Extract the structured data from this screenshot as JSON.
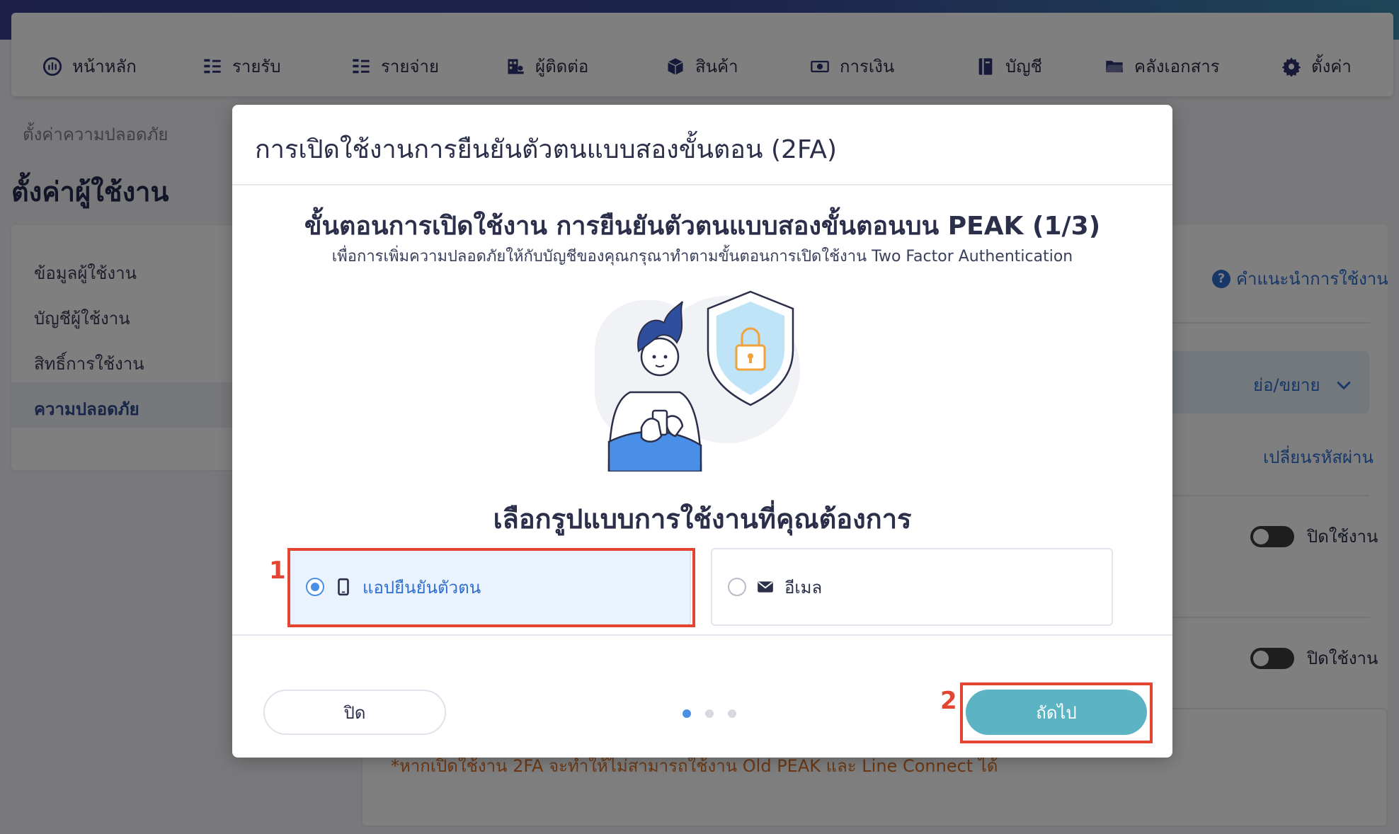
{
  "nav": {
    "items": [
      {
        "label": "หน้าหลัก",
        "icon": "dashboard-icon"
      },
      {
        "label": "รายรับ",
        "icon": "income-icon"
      },
      {
        "label": "รายจ่าย",
        "icon": "expense-icon"
      },
      {
        "label": "ผู้ติดต่อ",
        "icon": "contacts-icon"
      },
      {
        "label": "สินค้า",
        "icon": "product-box-icon"
      },
      {
        "label": "การเงิน",
        "icon": "money-icon"
      },
      {
        "label": "บัญชี",
        "icon": "ledger-book-icon"
      },
      {
        "label": "คลังเอกสาร",
        "icon": "folder-icon"
      },
      {
        "label": "ตั้งค่า",
        "icon": "gear-icon"
      }
    ]
  },
  "page": {
    "breadcrumb": "ตั้งค่าความปลอดภัย",
    "title": "ตั้งค่าผู้ใช้งาน",
    "sidebar": {
      "items": [
        {
          "label": "ข้อมูลผู้ใช้งาน",
          "active": false
        },
        {
          "label": "บัญชีผู้ใช้งาน",
          "active": false
        },
        {
          "label": "สิทธิ์การใช้งาน",
          "active": false
        },
        {
          "label": "ความปลอดภัย",
          "active": true
        }
      ]
    },
    "help_link": "คำแนะนำการใช้งาน",
    "collapse_label": "ย่อ/ขยาย",
    "change_password": "เปลี่ยนรหัสผ่าน",
    "toggles": [
      {
        "label": "ปิดใช้งาน",
        "on": false
      },
      {
        "label": "ปิดใช้งาน",
        "on": false
      }
    ],
    "warning": "*หากเปิดใช้งาน 2FA จะทำให้ไม่สามารถใช้งาน Old PEAK และ Line Connect ได้"
  },
  "modal": {
    "title": "การเปิดใช้งานการยืนยันตัวตนแบบสองขั้นตอน (2FA)",
    "step_title": "ขั้นตอนการเปิดใช้งาน การยืนยันตัวตนแบบสองขั้นตอนบน PEAK (1/3)",
    "step_subtitle": "เพื่อการเพิ่มความปลอดภัยให้กับบัญชีของคุณกรุณาทำตามขั้นตอนการเปิดใช้งาน Two Factor Authentication",
    "choose_title": "เลือกรูปแบบการใช้งานที่คุณต้องการ",
    "options": [
      {
        "label": "แอปยืนยันตัวตน",
        "icon": "smartphone-icon",
        "selected": true
      },
      {
        "label": "อีเมล",
        "icon": "envelope-icon",
        "selected": false
      }
    ],
    "close_button": "ปิด",
    "next_button": "ถัดไป",
    "steps_total": 3,
    "step_current": 1,
    "annotations": [
      "1",
      "2"
    ]
  },
  "colors": {
    "accent_blue": "#4a8fe7",
    "next_button": "#5bb3c4",
    "highlight_red": "#e24633",
    "nav_dark": "#2c3370"
  }
}
